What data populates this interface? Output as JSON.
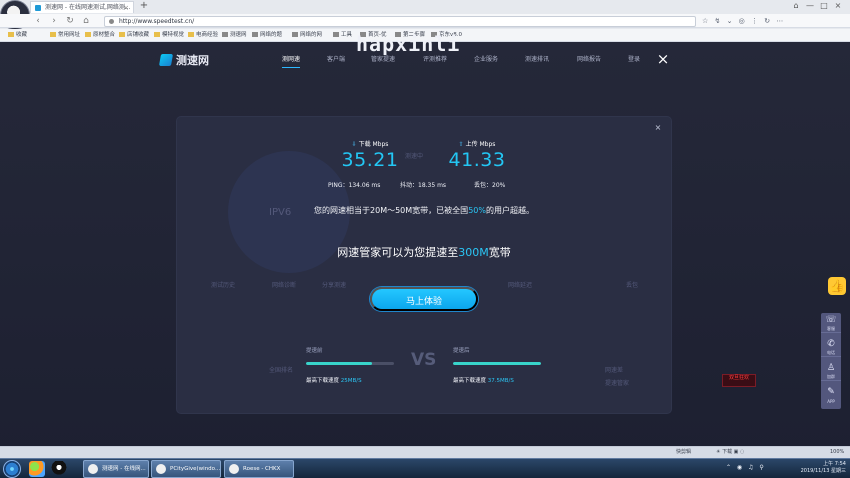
{
  "browser": {
    "tab_title": "测速网 - 在线网速测试,网络测...",
    "tab_close": "×",
    "new_tab": "+",
    "url": "http://www.speedtest.cn/",
    "toolbar_icons": "☆ ↯ ⌄ ◎ ⋮ ↻ ⋯",
    "window_buttons": [
      "⌂",
      "—",
      "□",
      "×"
    ],
    "bookmarks": [
      "收藏",
      "常用网址",
      "原材整合",
      "店铺收藏",
      "模特视觉",
      "电商经验",
      "测速网",
      "网络的题",
      "网络的网",
      "工具",
      "首页-优",
      "第二步骤",
      "京东v8.0"
    ]
  },
  "watermark": "hapxinli",
  "site": {
    "logo_text": "测速网",
    "nav": [
      "测网速",
      "客户端",
      "管家提速",
      "评测推荐",
      "企业服务",
      "测速排讯",
      "网络报告",
      "登录"
    ],
    "active_nav": "测网速",
    "close": "×"
  },
  "background_faded": {
    "left_top": "测速中",
    "ring_label": "IPV6",
    "row_items": [
      "测试历史",
      "网络诊断",
      "分享测速"
    ],
    "right_items": [
      "网络延迟",
      "丢包"
    ],
    "lower_left": "全国排名",
    "lower_right": [
      "网速差",
      "提速管家"
    ]
  },
  "card": {
    "close": "×",
    "download": {
      "label": "下载 Mbps",
      "value": "35.21",
      "arrow": "⇩"
    },
    "upload": {
      "label": "上传 Mbps",
      "value": "41.33",
      "arrow": "⇧"
    },
    "ping": "PING：134.06 ms",
    "jitter": "抖动：18.35 ms",
    "loss": "丢包：20%",
    "summary_prefix": "您的网速相当于20M～50M宽带，已被全国",
    "summary_percent": "50%",
    "summary_suffix": "的用户超越。",
    "promo_prefix": "网速管家可以为您提速至",
    "promo_highlight": "300M",
    "promo_suffix": "宽带",
    "cta": "马上体验",
    "before_label": "提速前",
    "after_label": "提速后",
    "before_progress_percent": 75,
    "after_progress_percent": 100,
    "vs": "VS",
    "before_max_prefix": "最高下载速度",
    "before_max_value": "25MB/S",
    "after_max_prefix": "最高下载速度",
    "after_max_value": "37.5MB/S"
  },
  "side_rail": [
    {
      "icon": "☏",
      "label": "客服"
    },
    {
      "icon": "✆",
      "label": "电话"
    },
    {
      "icon": "♙",
      "label": "加群"
    },
    {
      "icon": "✎",
      "label": "APP"
    }
  ],
  "red_stamp": "双旦狂欢",
  "statusbar": {
    "left": "快剪辑",
    "icons": "☀ 下载 ▣ ◌",
    "zoom": "100%"
  },
  "taskbar": {
    "items": [
      "测速网 - 在线网...",
      "PCityGive(windo...",
      "Roese - CHKX"
    ],
    "time": "上午 7:54",
    "date": "2019/11/13 星期三",
    "tray_icons": "⌃ ◉ ♫ ⚲"
  }
}
